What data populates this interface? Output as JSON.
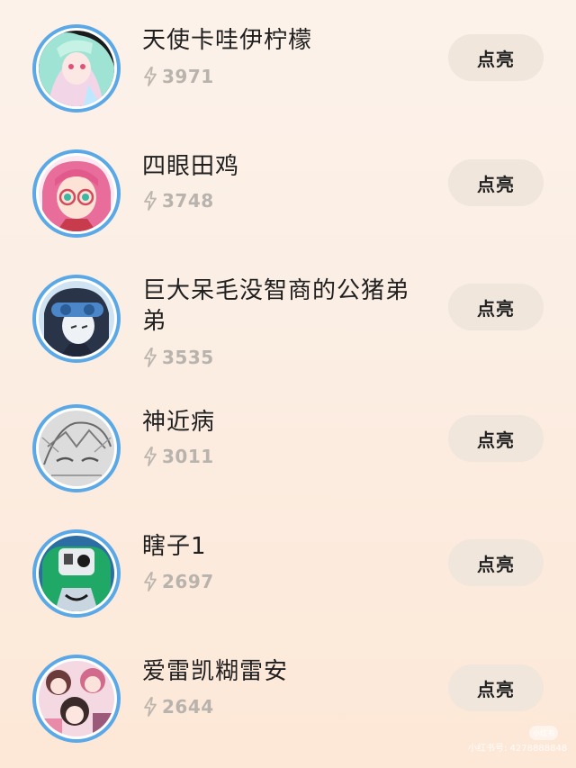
{
  "button_label": "点亮",
  "accent": "#5aa8e6",
  "users": [
    {
      "name": "天使卡哇伊柠檬",
      "score": "3971",
      "avatar_icon": "anime-girl-teal-hair-avatar"
    },
    {
      "name": "四眼田鸡",
      "score": "3748",
      "avatar_icon": "anime-girl-pink-hair-glasses-avatar"
    },
    {
      "name": "巨大呆毛没智商的公猪弟弟",
      "score": "3535",
      "avatar_icon": "anime-boy-goggles-avatar"
    },
    {
      "name": "神近病",
      "score": "3011",
      "avatar_icon": "sketch-face-avatar"
    },
    {
      "name": "瞎子1",
      "score": "2697",
      "avatar_icon": "green-hair-robot-avatar"
    },
    {
      "name": "爱雷凯糊雷安",
      "score": "2644",
      "avatar_icon": "anime-group-collage-avatar"
    }
  ],
  "watermark": {
    "badge": "小红书",
    "text": "小红书号: 4278888848"
  }
}
